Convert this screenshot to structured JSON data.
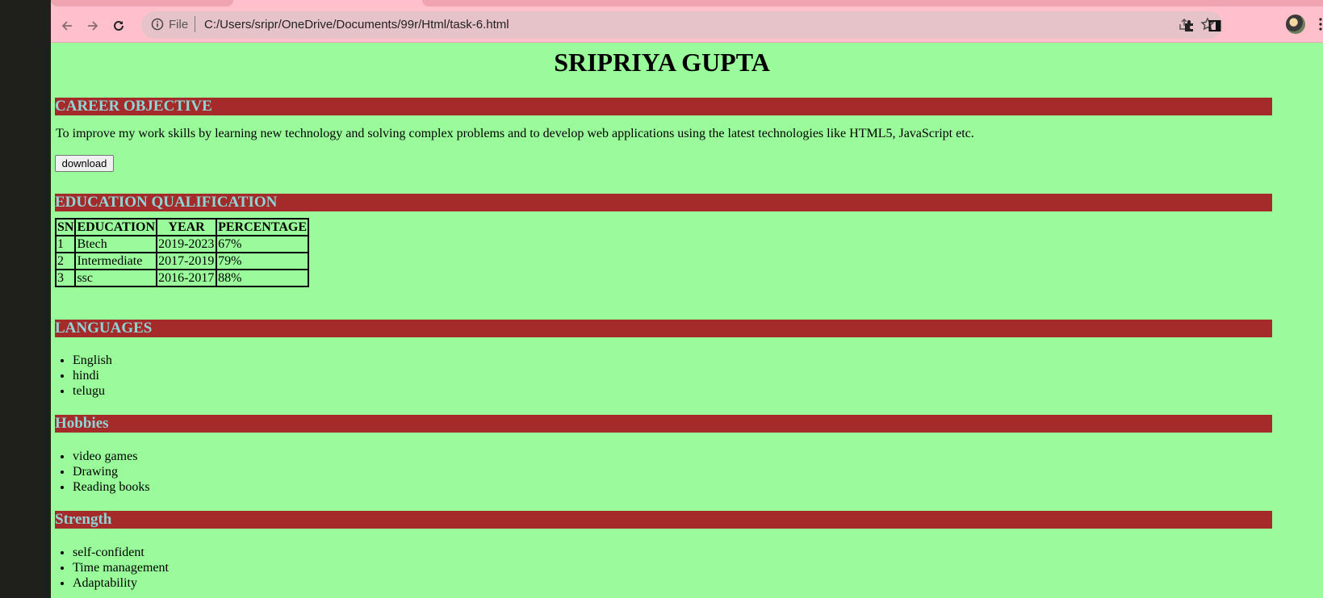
{
  "browser": {
    "scheme_label": "File",
    "url": "C:/Users/sripr/OneDrive/Documents/99r/Html/task-6.html",
    "icons": [
      "back-icon",
      "forward-icon",
      "reload-icon",
      "info-icon",
      "share-icon",
      "star-icon",
      "extensions-icon",
      "side-panel-icon",
      "avatar",
      "menu-icon"
    ]
  },
  "resume": {
    "name": "SRIPRIYA GUPTA",
    "career_objective": {
      "heading": "CAREER OBJECTIVE",
      "text": "To improve my work skills by learning new technology and solving complex problems and to develop web applications using the latest technologies like HTML5, JavaScript etc.",
      "download_label": "download"
    },
    "education": {
      "heading": "EDUCATION QUALIFICATION",
      "columns": [
        "SN",
        "EDUCATION",
        "YEAR",
        "PERCENTAGE"
      ],
      "rows": [
        [
          "1",
          "Btech",
          "2019-2023",
          "67%"
        ],
        [
          "2",
          "Intermediate",
          "2017-2019",
          "79%"
        ],
        [
          "3",
          "ssc",
          "2016-2017",
          "88%"
        ]
      ]
    },
    "languages": {
      "heading": "LANGUAGES",
      "items": [
        "English",
        "hindi",
        "telugu"
      ]
    },
    "hobbies": {
      "heading": "Hobbies",
      "items": [
        "video games",
        "Drawing",
        "Reading books"
      ]
    },
    "strength": {
      "heading": "Strength",
      "items": [
        "self-confident",
        "Time management",
        "Adaptability"
      ]
    }
  },
  "colors": {
    "page_background": "#99fb99",
    "heading_band": "#a52a2a",
    "heading_text": "#8ed6d6",
    "browser_chrome": "#ffc0cb"
  }
}
